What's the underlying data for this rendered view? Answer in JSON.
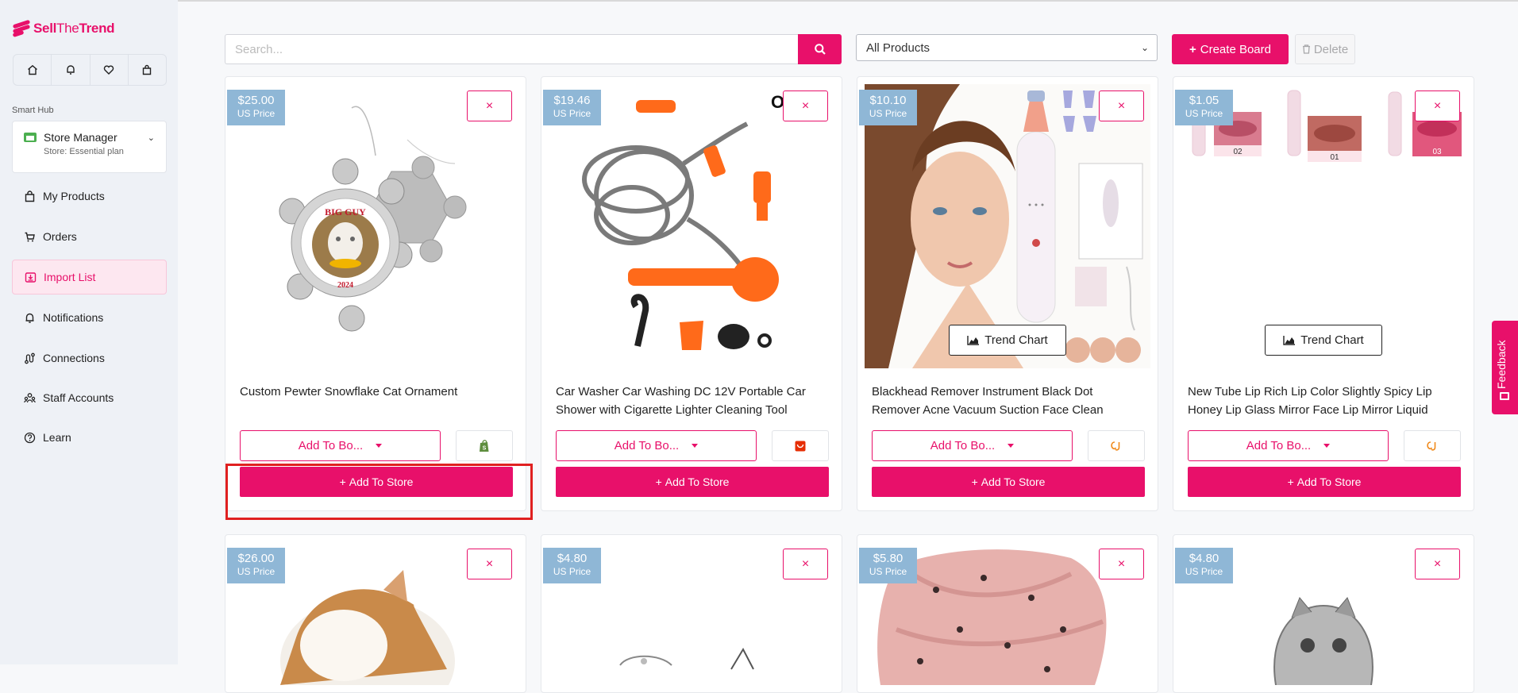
{
  "brand": {
    "name_bold": "Sell",
    "name_thin": "The",
    "name_end": "Trend"
  },
  "sidebar": {
    "section_label": "Smart Hub",
    "store": {
      "name": "Store Manager",
      "plan": "Store: Essential plan"
    },
    "items": [
      {
        "label": "My Products",
        "icon": "bag-icon"
      },
      {
        "label": "Orders",
        "icon": "cart-icon"
      },
      {
        "label": "Import List",
        "icon": "import-icon",
        "active": true
      },
      {
        "label": "Notifications",
        "icon": "bell-icon"
      },
      {
        "label": "Connections",
        "icon": "route-icon"
      },
      {
        "label": "Staff Accounts",
        "icon": "users-icon"
      },
      {
        "label": "Learn",
        "icon": "help-icon"
      }
    ]
  },
  "toolbar": {
    "search_placeholder": "Search...",
    "filter_value": "All Products",
    "create_label": "Create Board",
    "delete_label": "Delete"
  },
  "common": {
    "price_unit": "US Price",
    "add_to_board": "Add To Bo...",
    "add_to_store": "Add To Store",
    "trend_chart": "Trend Chart",
    "close": "×",
    "feedback": "Feedback"
  },
  "products": [
    {
      "price": "$25.00",
      "title": "Custom Pewter Snowflake Cat Ornament",
      "source": "shopify-icon"
    },
    {
      "price": "$19.46",
      "title": "Car Washer Car Washing DC 12V Portable Car Shower with Cigarette Lighter Cleaning Tool",
      "source": "aliexpress-icon",
      "img_text": "Or"
    },
    {
      "price": "$10.10",
      "title": "Blackhead Remover Instrument Black Dot Remover Acne Vacuum Suction Face Clean",
      "source": "cj-icon",
      "trend": true
    },
    {
      "price": "$1.05",
      "title": "New Tube Lip Rich Lip Color Slightly Spicy Lip Honey Lip Glass Mirror Face Lip Mirror Liquid",
      "source": "cj-icon",
      "trend": true,
      "swatches": [
        "02",
        "01",
        "03"
      ]
    },
    {
      "price": "$26.00"
    },
    {
      "price": "$4.80"
    },
    {
      "price": "$5.80"
    },
    {
      "price": "$4.80"
    }
  ],
  "ornament_text": {
    "top": "BIG GUY",
    "year": "2024"
  }
}
